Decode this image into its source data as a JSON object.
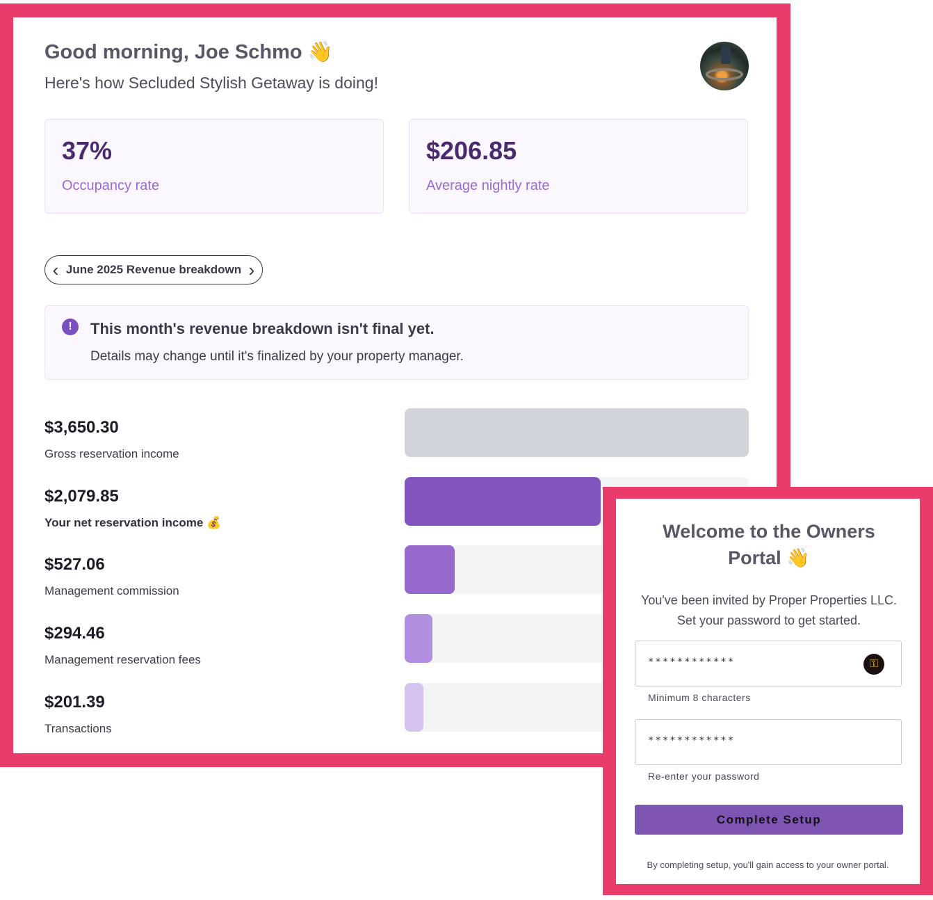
{
  "dashboard": {
    "greeting": "Good morning, Joe Schmo",
    "greeting_emoji": "👋",
    "subtitle": "Here's how Secluded Stylish Getaway is doing!",
    "stats": [
      {
        "value": "37%",
        "label": "Occupancy rate"
      },
      {
        "value": "$206.85",
        "label": "Average nightly rate"
      }
    ],
    "month_nav": {
      "label": "June 2025 Revenue breakdown",
      "prev_icon": "chevron-left-icon",
      "next_icon": "chevron-right-icon"
    },
    "notice": {
      "icon": "!",
      "title": "This month's revenue breakdown isn't final yet.",
      "body": "Details may change until it's finalized by your property manager."
    },
    "revenue": [
      {
        "value": "$3,650.30",
        "label": "Gross reservation income",
        "fraction": 1.0,
        "color": "#d1d5db",
        "strong": false,
        "emoji": ""
      },
      {
        "value": "$2,079.85",
        "label": "Your net reservation income",
        "fraction": 0.57,
        "color": "#8155bd",
        "strong": true,
        "emoji": "💰"
      },
      {
        "value": "$527.06",
        "label": "Management commission",
        "fraction": 0.145,
        "color": "#9869cd",
        "strong": false,
        "emoji": ""
      },
      {
        "value": "$294.46",
        "label": "Management reservation fees",
        "fraction": 0.081,
        "color": "#b28ee0",
        "strong": false,
        "emoji": ""
      },
      {
        "value": "$201.39",
        "label": "Transactions",
        "fraction": 0.055,
        "color": "#d6c3f0",
        "strong": false,
        "emoji": ""
      }
    ]
  },
  "login": {
    "title": "Welcome to the Owners Portal",
    "title_emoji": "👋",
    "intro": "You've been invited by Proper Properties LLC. Set your password to get started.",
    "password_value": "************",
    "password_hint": "Minimum 8 characters",
    "password_icon": "key-icon",
    "confirm_value": "************",
    "confirm_hint": "Re-enter your password",
    "button_label": "Complete Setup",
    "footnote": "By completing setup, you'll gain access to your owner portal."
  },
  "colors": {
    "frame": "#e93c6b",
    "accent": "#7e55b3",
    "stat_value": "#4a2a6e",
    "stat_label": "#9a6ad1"
  }
}
